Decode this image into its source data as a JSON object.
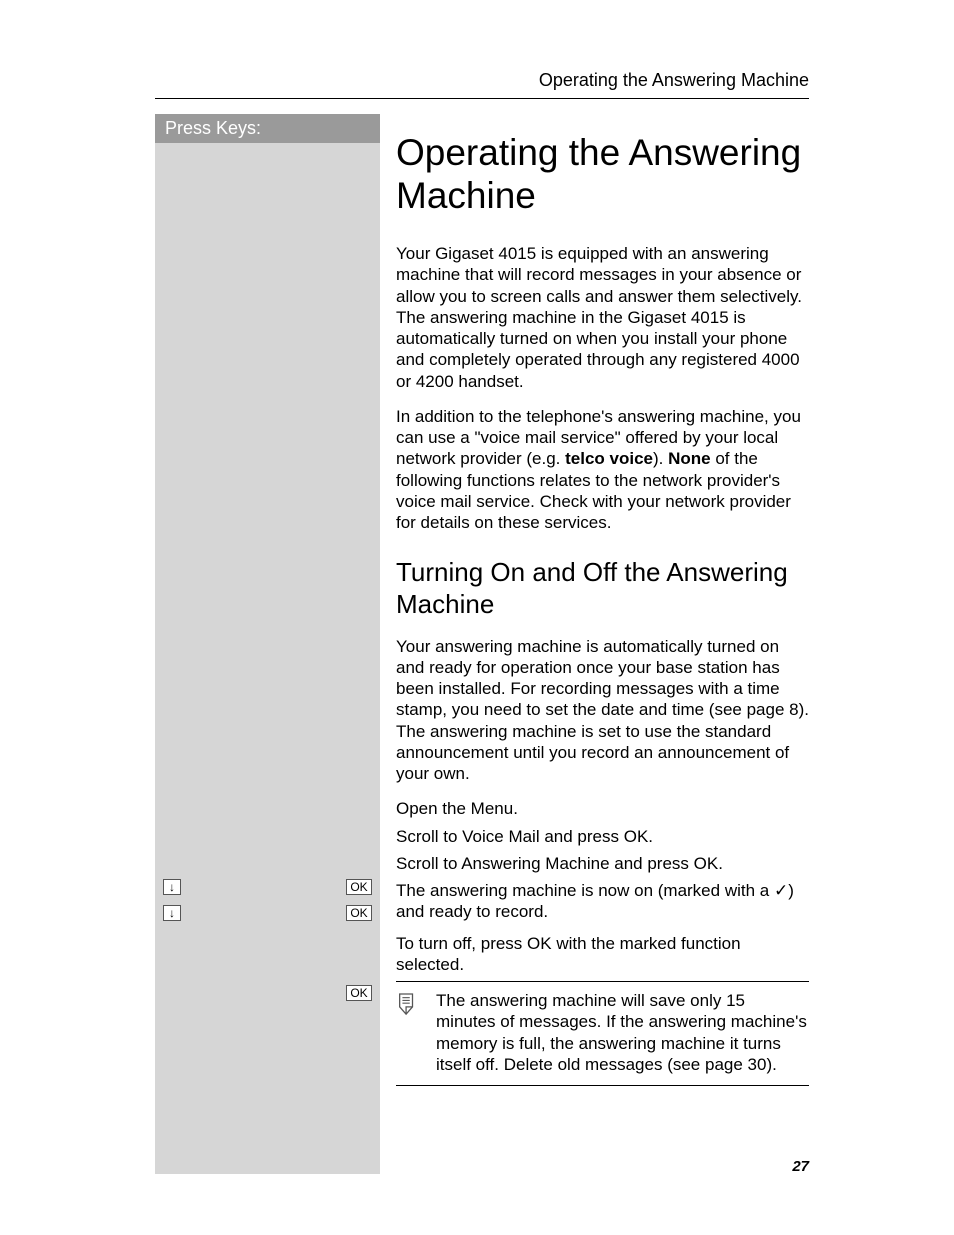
{
  "running_head": "Operating the Answering Machine",
  "sidebar": {
    "title": "Press Keys:"
  },
  "keys": {
    "ok": "OK",
    "down": "↓"
  },
  "h1": "Operating the Answering Machine",
  "p1a": "Your Gigaset 4015 is equipped with an answering machine that will record messages in your absence or allow you to screen calls and answer them selectively.  The answering machine in the Gigaset 4015 is automatically turned on when you install your phone and completely operated through any registered 4000 or 4200 handset.",
  "p1b_pre": "In addition to the telephone's answering machine, you can use a \"voice mail service\" offered by your local network provider (e.g. ",
  "p1b_bold1": "telco voice",
  "p1b_mid": "). ",
  "p1b_bold2": "None",
  "p1b_post": " of the following functions relates to the network provider's voice mail service.  Check with your network provider for details on these services.",
  "h2": "Turning On and Off the Answering Machine",
  "p2": "Your answering machine is automatically turned on and ready for operation once your base station has been installed. For recording messages with a time stamp, you need to set the date and time (see page 8). The answering machine is set to use the standard announcement until you record an announcement of your own.",
  "steps": {
    "s1": "Open the Menu.",
    "s2": "Scroll to Voice Mail and press OK.",
    "s3": "Scroll to Answering Machine and press OK.",
    "s4a": "The answering machine is now on (marked with a ",
    "s4b": ") and ready to record.",
    "s5": "To turn off, press OK with the marked function selected."
  },
  "note": "The answering machine will save only 15 minutes of messages. If the answering machine's memory is full, the answering machine it turns itself off. Delete old messages (see page 30).",
  "page_number": "27",
  "check": "✓"
}
